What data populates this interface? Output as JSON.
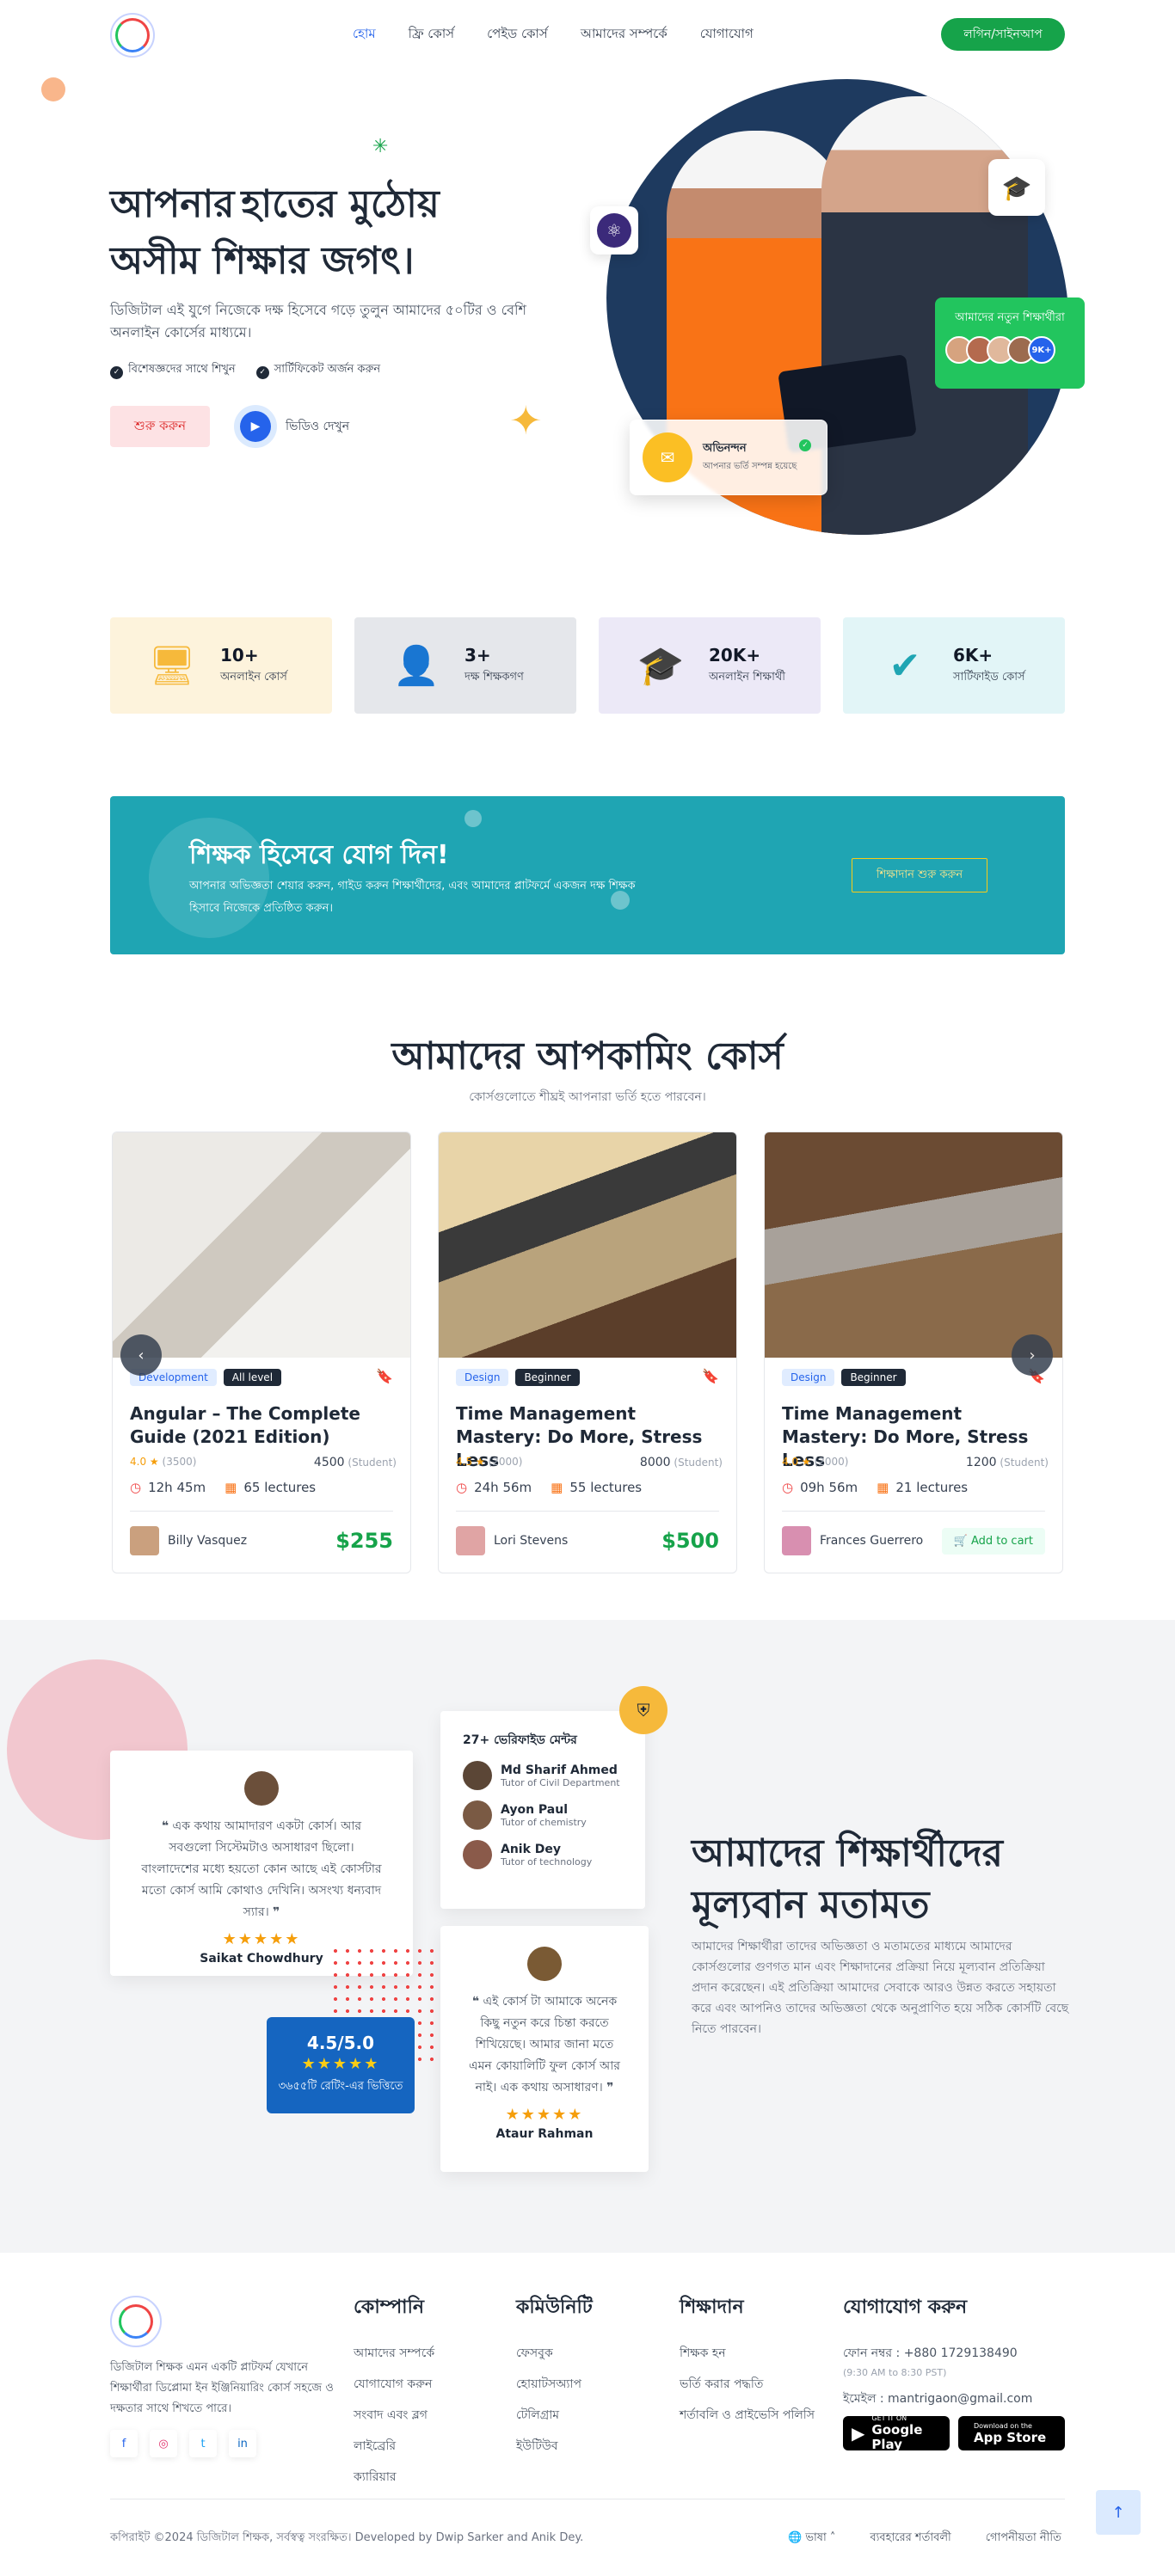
{
  "header": {
    "logo_alt": "digital shikkhok logo",
    "nav": [
      "হোম",
      "ফ্রি কোর্স",
      "পেইড কোর্স",
      "আমাদের সম্পর্কে",
      "যোগাযোগ"
    ],
    "login_label": "লগিন/সাইনআপ"
  },
  "hero": {
    "title_part1": "আপনার",
    "title_highlight": "হাতের মুঠোয়",
    "title_line2": "অসীম শিক্ষার জগৎ।",
    "subtitle": "ডিজিটাল এই যুগে নিজেকে দক্ষ হিসেবে গড়ে তুলুন আমাদের ৫০টির ও বেশি অনলাইন কোর্সের মাধ্যমে।",
    "check1": "বিশেষজ্ঞদের সাথে শিখুন",
    "check2": "সার্টিফিকেট অর্জন করুন",
    "start_button": "শুরু করুন",
    "video_label": "ভিডিও দেখুন",
    "new_students_title": "আমাদের নতুন শিক্ষার্থীরা",
    "new_students_count": "9K+",
    "applied_title": "অভিনন্দন",
    "applied_sub": "আপনার ভর্তি সম্পন্ন হয়েছে"
  },
  "stats": [
    {
      "value": "10+",
      "label": "অনলাইন কোর্স",
      "icon": "monitor-icon",
      "bg": "#fdf3dc",
      "color": "#f6b93b"
    },
    {
      "value": "3+",
      "label": "দক্ষ শিক্ষকগণ",
      "icon": "teacher-icon",
      "bg": "#e5e7eb",
      "color": "#1e3a5f"
    },
    {
      "value": "20K+",
      "label": "অনলাইন শিক্ষার্থী",
      "icon": "graduate-icon",
      "bg": "#ece9f7",
      "color": "#6d28d9"
    },
    {
      "value": "6K+",
      "label": "সার্টিফাইড কোর্স",
      "icon": "certified-icon",
      "bg": "#e2f5f7",
      "color": "#1fa5b3"
    }
  ],
  "teacher_banner": {
    "title": "শিক্ষক হিসেবে যোগ দিন!",
    "text": "আপনার অভিজ্ঞতা শেয়ার করুন, গাইড করুন শিক্ষার্থীদের, এবং আমাদের প্লাটফর্মে একজন দক্ষ শিক্ষক হিসাবে নিজেকে প্রতিষ্ঠিত করুন।",
    "button": "শিক্ষাদান শুরু করুন"
  },
  "courses_section": {
    "title": "আমাদের আপকামিং কোর্স",
    "subtitle": "কোর্সগুলোতে শীঘ্রই আপনারা ভর্তি হতে পারবেন।"
  },
  "courses": [
    {
      "category": "Development",
      "level": "All level",
      "title": "Angular – The Complete Guide (2021 Edition)",
      "rating": "4.0",
      "reviews": "(3500)",
      "students": "4500",
      "students_label": "(Student)",
      "duration": "12h 45m",
      "lectures": "65 lectures",
      "instructor": "Billy Vasquez",
      "price": "$255"
    },
    {
      "category": "Design",
      "level": "Beginner",
      "title": "Time Management Mastery: Do More, Stress Less",
      "rating": "4.5",
      "reviews": "(2000)",
      "students": "8000",
      "students_label": "(Student)",
      "duration": "24h 56m",
      "lectures": "55 lectures",
      "instructor": "Lori Stevens",
      "price": "$500"
    },
    {
      "category": "Design",
      "level": "Beginner",
      "title": "Time Management Mastery: Do More, Stress Less",
      "rating": "4.0",
      "reviews": "(2000)",
      "students": "1200",
      "students_label": "(Student)",
      "duration": "09h 56m",
      "lectures": "21 lectures",
      "instructor": "Frances Guerrero",
      "cart": "Add to cart"
    }
  ],
  "testimonials": {
    "t1_quote": "এক কথায় আমাদারণ একটা কোর্স। আর সবগুলো সিস্টেমটাও অসাধারণ ছিলো। বাংলাদেশের মধ্যে হয়তো কোন আছে এই কোর্সটার মতো কোর্স আমি কোথাও দেখিনি। অসংখ্য ধন্যবাদ স্যার।",
    "t1_name": "Saikat Chowdhury",
    "t2_quote": "এই কোর্স টা আমাকে অনেক কিছু নতুন করে চিন্তা করতে শিখিয়েছে। আমার জানা মতে এমন কোয়ালিটি ফুল কোর্স আর নাই। এক কথায় অসাধারণ।",
    "t2_name": "Ataur Rahman",
    "stars": "★★★★★",
    "mentors_title": "27+ ভেরিফাইড মেন্টর",
    "mentors": [
      {
        "name": "Md Sharif Ahmed",
        "role": "Tutor of Civil Department"
      },
      {
        "name": "Ayon Paul",
        "role": "Tutor of chemistry"
      },
      {
        "name": "Anik Dey",
        "role": "Tutor of technology"
      }
    ],
    "rating_value": "4.5/5.0",
    "rating_label": "৩৬৫৫টি রেটিং-এর ভিত্তিতে",
    "title": "আমাদের শিক্ষার্থীদের মূল্যবান মতামত",
    "subtitle": "আমাদের শিক্ষার্থীরা তাদের অভিজ্ঞতা ও মতামতের মাধ্যমে আমাদের কোর্সগুলোর গুণগত মান এবং শিক্ষাদানের প্রক্রিয়া নিয়ে মূল্যবান প্রতিক্রিয়া প্রদান করেছেন। এই প্রতিক্রিয়া আমাদের সেবাকে আরও উন্নত করতে সহায়তা করে এবং আপনিও তাদের অভিজ্ঞতা থেকে অনুপ্রাণিত হয়ে সঠিক কোর্সটি বেছে নিতে পারবেন।"
  },
  "footer": {
    "desc": "ডিজিটাল শিক্ষক এমন একটি প্লাটফর্ম যেখানে শিক্ষার্থীরা ডিপ্লোমা ইন ইঞ্জিনিয়ারিং কোর্স সহজে ও দক্ষতার সাথে শিখতে পারে।",
    "company_title": "কোম্পানি",
    "company": [
      "আমাদের সম্পর্কে",
      "যোগাযোগ করুন",
      "সংবাদ এবং ব্লগ",
      "লাইব্রেরি",
      "ক্যারিয়ার"
    ],
    "community_title": "কমিউনিটি",
    "community": [
      "ফেসবুক",
      "হোয়াটসঅ্যাপ",
      "টেলিগ্রাম",
      "ইউটিউব"
    ],
    "teaching_title": "শিক্ষাদান",
    "teaching": [
      "শিক্ষক হন",
      "ভর্তি করার পদ্ধতি",
      "শর্তাবলি ও প্রাইভেসি পলিসি"
    ],
    "contact_title": "যোগাযোগ করুন",
    "phone": "ফোন নম্বর : +880 1729138490",
    "phone_hours": "(9:30 AM to 8:30 PST)",
    "email": "ইমেইল : mantrigaon@gmail.com",
    "google_play_small": "GET IT ON",
    "google_play": "Google Play",
    "app_store_small": "Download on the",
    "app_store": "App Store",
    "copyright": "কপিরাইট ©2024 ডিজিটাল শিক্ষক, সর্বস্বত্ব সংরক্ষিত। Developed by Dwip Sarker and Anik Dey.",
    "language": "ভাষা",
    "terms": "ব্যবহারের শর্তাবলী",
    "privacy": "গোপনীয়তা নীতি"
  }
}
